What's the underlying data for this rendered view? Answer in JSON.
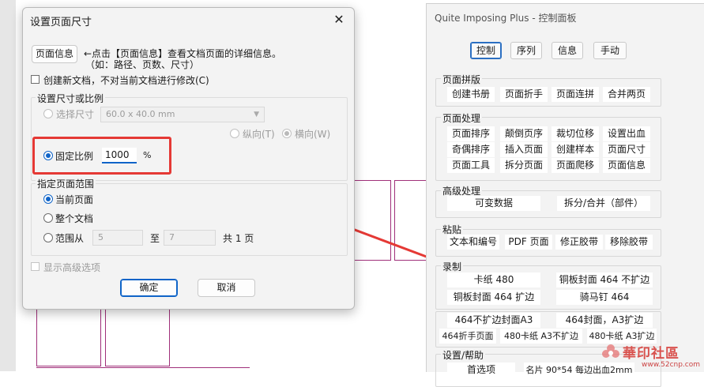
{
  "dialog": {
    "title": "设置页面尺寸",
    "page_info_button": "页面信息",
    "info_line1": "←点击【页面信息】查看文档页面的详细信息。",
    "info_line2": "（如：路径、页数、尺寸）",
    "new_doc_checkbox": "创建新文档，不对当前文档进行修改(C)",
    "size_group": {
      "label": "设置尺寸或比例",
      "select_size_label": "选择尺寸",
      "size_value": "60.0 x 40.0 mm",
      "portrait_label": "纵向(T)",
      "landscape_label": "横向(W)",
      "fixed_ratio_label": "固定比例",
      "ratio_value": "1000",
      "ratio_unit": "%"
    },
    "range_group": {
      "label": "指定页面范围",
      "current_page": "当前页面",
      "whole_doc": "整个文档",
      "range_from": "范围从",
      "from_value": "5",
      "to_label": "至",
      "to_value": "7",
      "total": "共 1 页"
    },
    "advanced_checkbox": "显示高级选项",
    "ok_button": "确定",
    "cancel_button": "取消"
  },
  "control_panel": {
    "title": "Quite Imposing Plus - 控制面板",
    "tabs": [
      "控制",
      "序列",
      "信息",
      "手动"
    ],
    "active_tab": "控制",
    "sections": [
      {
        "label": "页面拼版",
        "buttons": [
          "创建书册",
          "页面折手",
          "页面连拼",
          "合并两页"
        ]
      },
      {
        "label": "页面处理",
        "buttons": [
          "页面排序",
          "颠倒页序",
          "裁切位移",
          "设置出血",
          "奇偶排序",
          "插入页面",
          "创建样本",
          "页面尺寸",
          "页面工具",
          "拆分页面",
          "页面爬移",
          "页面信息"
        ]
      },
      {
        "label": "高级处理",
        "buttons": [
          "可变数据",
          "拆分/合并（部件）"
        ]
      },
      {
        "label": "粘贴",
        "buttons": [
          "文本和编号",
          "PDF 页面",
          "修正胶带",
          "移除胶带"
        ]
      },
      {
        "label": "录制",
        "buttons": [
          "卡纸 480",
          "铜板封面 464 不扩边",
          "铜板封面 464 扩边",
          "骑马钉 464"
        ]
      },
      {
        "label": "",
        "buttons": [
          "464不扩边封面A3",
          "464封面，A3扩边",
          "464折手页面",
          "480卡纸 A3不扩边",
          "480卡纸 A3扩边"
        ]
      },
      {
        "label": "设置/帮助",
        "buttons": [
          "首选项",
          "名片 90*54 每边出血2mm"
        ]
      }
    ]
  },
  "watermark": {
    "brand": "華印社區",
    "site": "www.52cnp.com"
  },
  "colors": {
    "accent": "#0f64c8",
    "arrow": "#e53935",
    "highlight_box": "#e53935",
    "page_outline": "#a0307a"
  }
}
